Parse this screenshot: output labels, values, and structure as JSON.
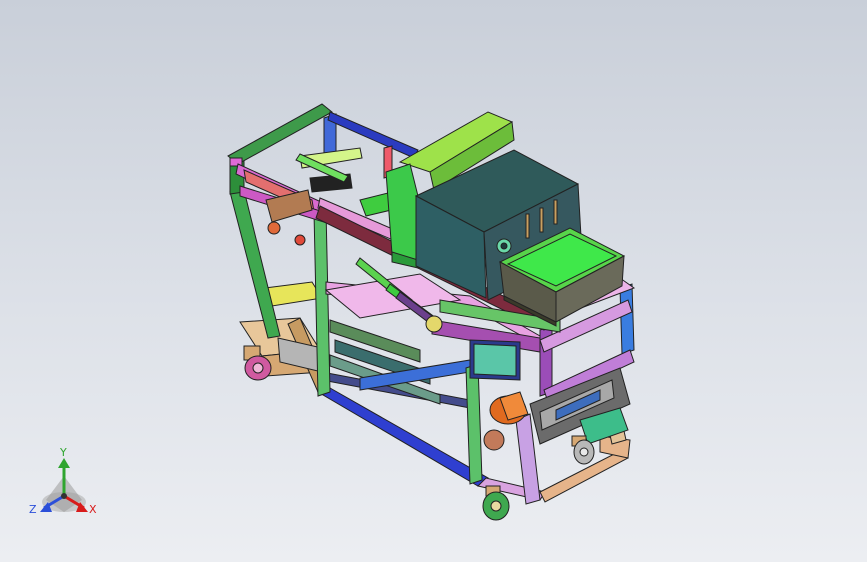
{
  "viewport": {
    "background_top": "#c9cfd9",
    "background_bottom": "#eceef2",
    "model_description_icon": "cad-machine-assembly"
  },
  "triad": {
    "x_label": "X",
    "y_label": "Y",
    "z_label": "Z",
    "x_color": "#d81b1b",
    "y_color": "#2fa52f",
    "z_color": "#2b4fd9"
  }
}
